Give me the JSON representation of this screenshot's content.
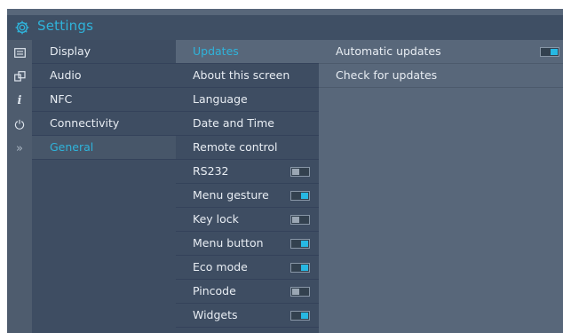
{
  "header": {
    "title": "Settings",
    "icon": "gear-icon"
  },
  "icon_rail": [
    {
      "icon": "display-icon"
    },
    {
      "icon": "audio-icon"
    },
    {
      "icon": "info-icon"
    },
    {
      "icon": "power-icon"
    },
    {
      "icon": "chevrons-right-icon"
    }
  ],
  "categories": [
    {
      "label": "Display"
    },
    {
      "label": "Audio"
    },
    {
      "label": "NFC"
    },
    {
      "label": "Connectivity"
    },
    {
      "label": "General",
      "selected": true
    }
  ],
  "general_items": [
    {
      "label": "Updates",
      "selected": true
    },
    {
      "label": "About this screen"
    },
    {
      "label": "Language"
    },
    {
      "label": "Date and Time"
    },
    {
      "label": "Remote control"
    },
    {
      "label": "RS232",
      "toggle": "off"
    },
    {
      "label": "Menu gesture",
      "toggle": "on"
    },
    {
      "label": "Key lock",
      "toggle": "off"
    },
    {
      "label": "Menu button",
      "toggle": "on"
    },
    {
      "label": "Eco mode",
      "toggle": "on"
    },
    {
      "label": "Pincode",
      "toggle": "off"
    },
    {
      "label": "Widgets",
      "toggle": "on"
    }
  ],
  "updates_items": [
    {
      "label": "Automatic updates",
      "toggle": "on"
    },
    {
      "label": "Check for updates"
    }
  ],
  "colors": {
    "accent": "#2fb3da",
    "toggle_on": "#27b8e3"
  }
}
